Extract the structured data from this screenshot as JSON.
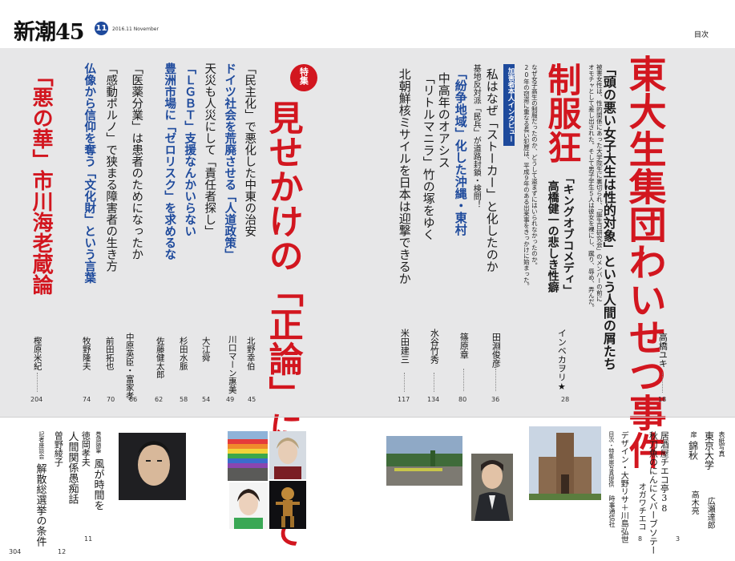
{
  "header": {
    "logo": "新潮45",
    "issue_number": "11",
    "issue_date": "2016.11 November",
    "section_label": "目次"
  },
  "colors": {
    "accent_red": "#d2161f",
    "accent_blue": "#1e4a9c",
    "band_gray": "#e7e7e8"
  },
  "feature": {
    "badge": "特集",
    "title": "見せかけの「正論」について"
  },
  "right_page": {
    "lead": {
      "title": "東大生集団わいせつ事件",
      "subtitle": "「頭の悪い女子大生は性的対象」という人間の屑たち",
      "author": "高橋ユキ",
      "page": "18"
    },
    "article2": {
      "title": "制服狂",
      "subtitle_a": "「キングオブコメディ」",
      "subtitle_b": "高橋健一の悲しき性癖",
      "author": "インベカヲリ★",
      "page": "28",
      "blurb_1": "被害女性は、性的関係にあった大学院生に裏切られ、「誕生日研究会」のメンバーの前に",
      "blurb_2": "オモチャとして差し出された。そして男子学生５人は彼女を裸にし、蹴り、辱め、弄んだ。",
      "blurb_3": "なぜ女子高生の制服だったのか、どうして盗まずにはいられなかったのか。",
      "blurb_4": "20年の窃盗に重なる長い犯歴は、平成９年のある出来事をきっかけに始まった。"
    },
    "interview": {
      "label": "加害者本人インタビュー",
      "title": "私はなぜ「ストーカー」と化したのか",
      "author": "田淵俊彦",
      "page": "36"
    },
    "okinawa": {
      "top": "基地反対派「民兵」が道路封鎖・検問！",
      "title": "「紛争地域」化した沖縄・東村",
      "author": "篠原章",
      "page": "80"
    },
    "oasis": {
      "line1": "中高年のオアシス",
      "line2": "「リトルマニラ」竹の塚をゆく",
      "author": "水谷竹秀",
      "page": "134"
    },
    "missile": {
      "title": "北朝鮮核ミサイルを日本は迎撃できるか",
      "author": "米田建三",
      "page": "117"
    }
  },
  "left_page": {
    "items": [
      {
        "title": "「民主化」で悪化した中東の治安",
        "author": "北野幸伯",
        "page": "45"
      },
      {
        "title": "ドイツ社会を荒廃させる「人道政策」",
        "author": "川口マーン惠美",
        "page": "49"
      },
      {
        "title": "天災も人災にして「責任者探し」",
        "author": "大江舜",
        "page": "54"
      },
      {
        "title": "「ＬＧＢＴ」支援なんかいらない",
        "author": "杉田水脈",
        "page": "58"
      },
      {
        "title": "豊洲市場に「ゼロリスク」を求めるな",
        "author": "佐藤健太郎",
        "page": "62"
      },
      {
        "title": "「医薬分業」は患者のためになったか",
        "author": "中原英臣・富家孝",
        "page": "66"
      },
      {
        "title": "「感動ポルノ」で狭まる障害者の生き方",
        "author": "前田拓也",
        "page": "70"
      },
      {
        "title": "仏像から信仰を奪う「文化財」という言葉",
        "author": "牧野隆夫",
        "page": "74"
      }
    ],
    "kabuki": {
      "title": "「悪の華」市川海老蔵論",
      "author": "樫原米紀",
      "page": "204"
    }
  },
  "bottom_right": {
    "photo_caption": "表紙写真",
    "col1": "東京大学",
    "col1_author": "広瀬達郎",
    "col2_label": "扉",
    "col2": "錦秋",
    "col2_author": "高木亮",
    "col2_page": "3",
    "col3a": "居酒屋チエコ亭38",
    "col3b": "秋刀魚のにんにくバーブソテー",
    "col3_author": "オガワチエコ",
    "col3_page": "8",
    "credits1": "デザイン・大野リサ＋川島弘世",
    "credits2": "目次・特集扉写真提供",
    "credits3": "時事通信社"
  },
  "bottom_left": {
    "col1_label": "巻頭随筆",
    "col1": "風が時間を",
    "col1_author": "徳岡孝夫",
    "col1_page": "11",
    "col2": "人間関係愚痴話",
    "col2_author": "曽野綾子",
    "col2_page": "12",
    "col3_label": "記者座談会",
    "col3": "解散総選挙の条件",
    "col3_page": "304"
  }
}
